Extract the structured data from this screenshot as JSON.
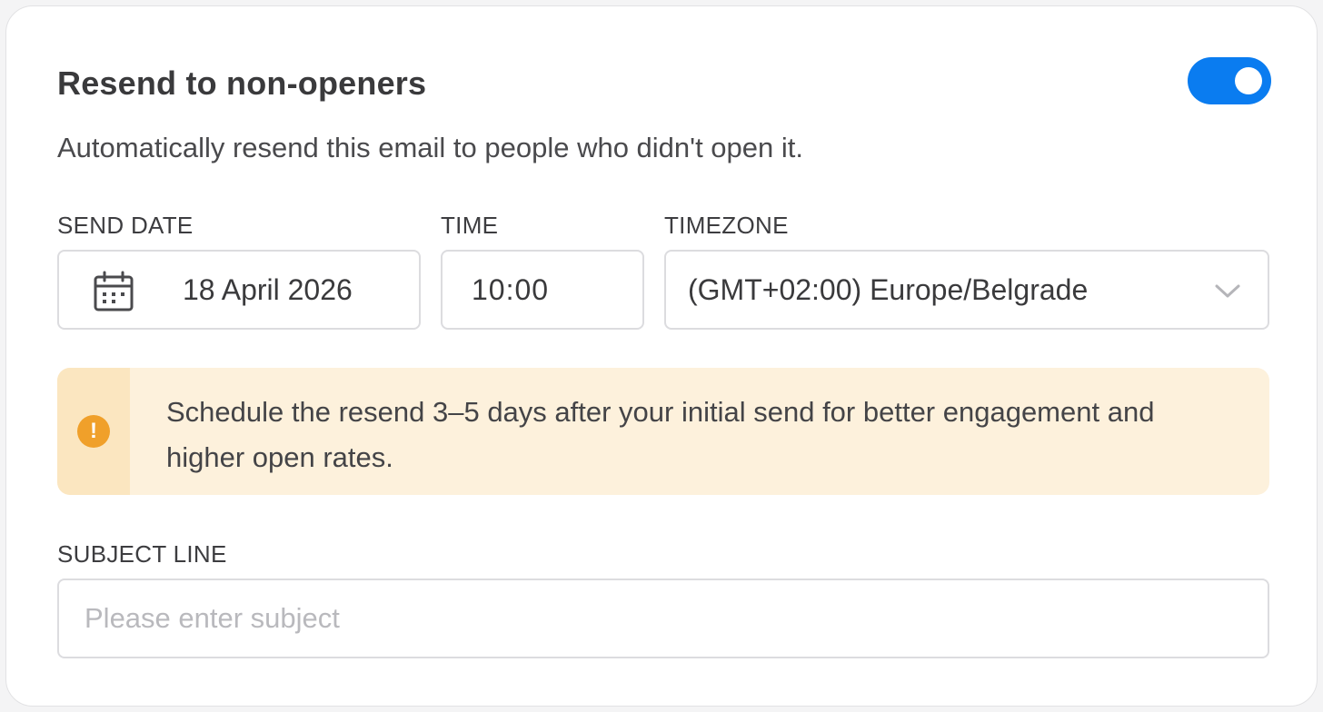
{
  "section": {
    "title": "Resend to non-openers",
    "description": "Automatically resend this email to people who didn't open it.",
    "toggle_on": true
  },
  "schedule": {
    "send_date_label": "SEND DATE",
    "send_date_value": "18 April 2026",
    "time_label": "TIME",
    "time_value": "10:00",
    "timezone_label": "TIMEZONE",
    "timezone_value": "(GMT+02:00) Europe/Belgrade"
  },
  "notice": {
    "text": "Schedule the resend 3–5 days after your initial send for better engagement and higher open rates.",
    "icon": "warning-icon"
  },
  "subject": {
    "label": "SUBJECT LINE",
    "value": "",
    "placeholder": "Please enter subject"
  },
  "colors": {
    "accent": "#0a7cf0",
    "notice_bg": "#fdf1dc",
    "warning": "#f0a02a"
  }
}
